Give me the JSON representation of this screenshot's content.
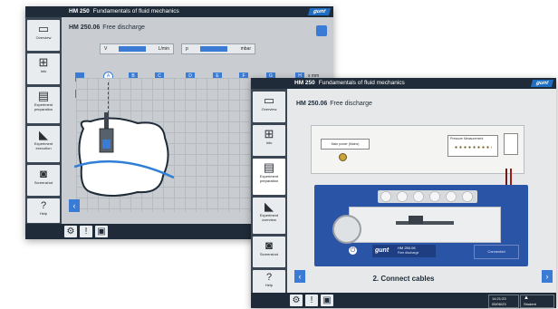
{
  "window1": {
    "app_title_prefix": "HM 250",
    "app_title": "Fundamentals of fluid mechanics",
    "brand": "gunt",
    "heading_code": "HM 250.06",
    "heading_text": "Free discharge",
    "field1_label": "V",
    "field1_unit": "L/min",
    "field2_label": "p",
    "field2_unit": "mbar",
    "axis_unit": "x mm",
    "markers": [
      "A",
      "B",
      "C",
      "D",
      "E",
      "F",
      "G",
      "H"
    ],
    "sidebar": [
      "Overview",
      "Info",
      "Experiment preparation",
      "Experiment execution",
      "Screenshot",
      "Help"
    ]
  },
  "window2": {
    "app_title_prefix": "HM 250",
    "app_title": "Fundamentals of fluid mechanics",
    "brand": "gunt",
    "heading_code": "HM 250.06",
    "heading_text": "Free discharge",
    "panel_left_label": "Main power (Mains)",
    "panel_right_label": "Pressure Measurement",
    "board_label": "HM 250.06",
    "board_sublabel": "Free discharge",
    "board_button": "Connected",
    "brand_board": "gunt",
    "caption": "2. Connect cables",
    "time": "14:21:23",
    "date": "05/06/23",
    "user": "Student",
    "sidebar": [
      "Overview",
      "Info",
      "Experiment preparation",
      "Experiment overview",
      "Screenshot",
      "Help"
    ]
  }
}
